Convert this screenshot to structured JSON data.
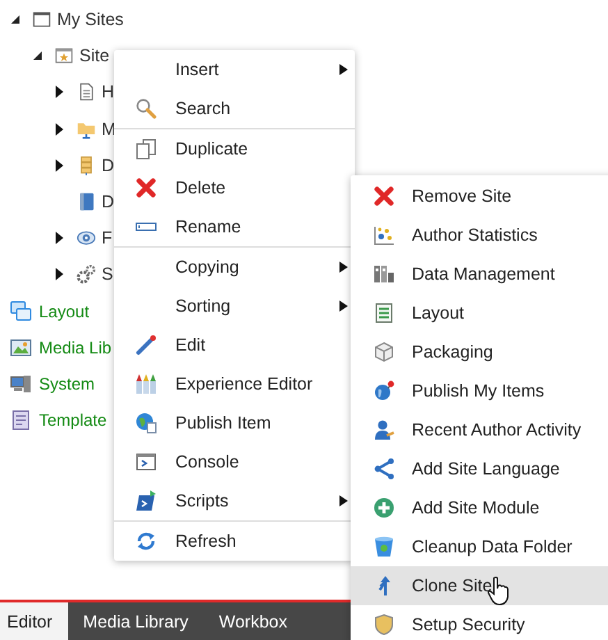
{
  "tree": [
    {
      "label": "My Sites",
      "expandable": true,
      "expanded": true,
      "children": [
        {
          "label": "Site",
          "expandable": true,
          "expanded": true,
          "children": [
            {
              "label": "H",
              "expandable": true,
              "expanded": false
            },
            {
              "label": "M",
              "expandable": true,
              "expanded": false
            },
            {
              "label": "D",
              "expandable": true,
              "expanded": false
            },
            {
              "label": "D",
              "expandable": false
            },
            {
              "label": "F",
              "expandable": true,
              "expanded": false
            },
            {
              "label": "S",
              "expandable": true,
              "expanded": false
            }
          ]
        }
      ]
    }
  ],
  "navigation": [
    {
      "label": "Layout"
    },
    {
      "label": "Media Lib"
    },
    {
      "label": "System"
    },
    {
      "label": "Template"
    }
  ],
  "tabs": [
    {
      "label": "Editor",
      "selected": true
    },
    {
      "label": "Media Library",
      "selected": false
    },
    {
      "label": "Workbox",
      "selected": false
    }
  ],
  "context_menu": {
    "items": [
      {
        "label": "Insert",
        "submenu": true,
        "separator_after": false
      },
      {
        "label": "Search",
        "submenu": false,
        "separator_after": true
      },
      {
        "label": "Duplicate",
        "submenu": false,
        "separator_after": false
      },
      {
        "label": "Delete",
        "submenu": false,
        "separator_after": false
      },
      {
        "label": "Rename",
        "submenu": false,
        "separator_after": true
      },
      {
        "label": "Copying",
        "submenu": true,
        "separator_after": false
      },
      {
        "label": "Sorting",
        "submenu": true,
        "separator_after": false
      },
      {
        "label": "Edit",
        "submenu": false,
        "separator_after": false
      },
      {
        "label": "Experience Editor",
        "submenu": false,
        "separator_after": false
      },
      {
        "label": "Publish Item",
        "submenu": false,
        "separator_after": false
      },
      {
        "label": "Console",
        "submenu": false,
        "separator_after": false
      },
      {
        "label": "Scripts",
        "submenu": true,
        "separator_after": true
      },
      {
        "label": "Refresh",
        "submenu": false,
        "separator_after": false
      }
    ]
  },
  "scripts_submenu": {
    "items": [
      {
        "label": "Remove Site",
        "selected": false
      },
      {
        "label": "Author Statistics",
        "selected": false
      },
      {
        "label": "Data Management",
        "selected": false
      },
      {
        "label": "Layout",
        "selected": false
      },
      {
        "label": "Packaging",
        "selected": false
      },
      {
        "label": "Publish My Items",
        "selected": false
      },
      {
        "label": "Recent Author Activity",
        "selected": false
      },
      {
        "label": "Add Site Language",
        "selected": false
      },
      {
        "label": "Add Site Module",
        "selected": false
      },
      {
        "label": "Cleanup Data Folder",
        "selected": false
      },
      {
        "label": "Clone Site",
        "selected": true
      },
      {
        "label": "Setup Security",
        "selected": false
      }
    ]
  }
}
